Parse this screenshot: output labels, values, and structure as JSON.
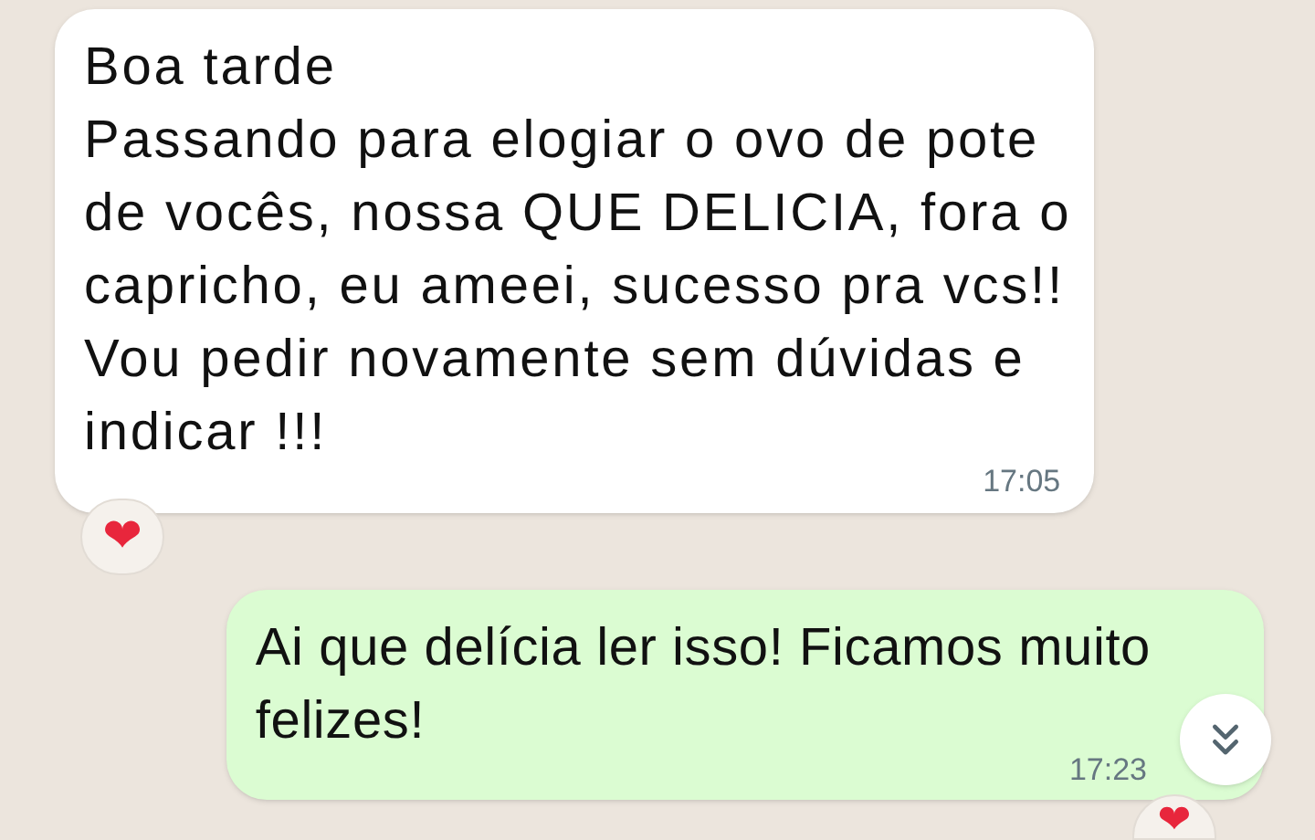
{
  "messages": [
    {
      "kind": "incoming",
      "text": "Boa tarde\nPassando para elogiar o ovo de pote\nde vocês, nossa QUE DELICIA, fora o\ncapricho, eu ameei, sucesso pra vcs!!\nVou pedir novamente sem dúvidas e\nindicar !!!",
      "time": "17:05",
      "reaction": "❤"
    },
    {
      "kind": "outgoing",
      "text": "Ai que delícia ler isso! Ficamos muito\nfelizes!",
      "time": "17:23",
      "reaction": "❤"
    }
  ]
}
